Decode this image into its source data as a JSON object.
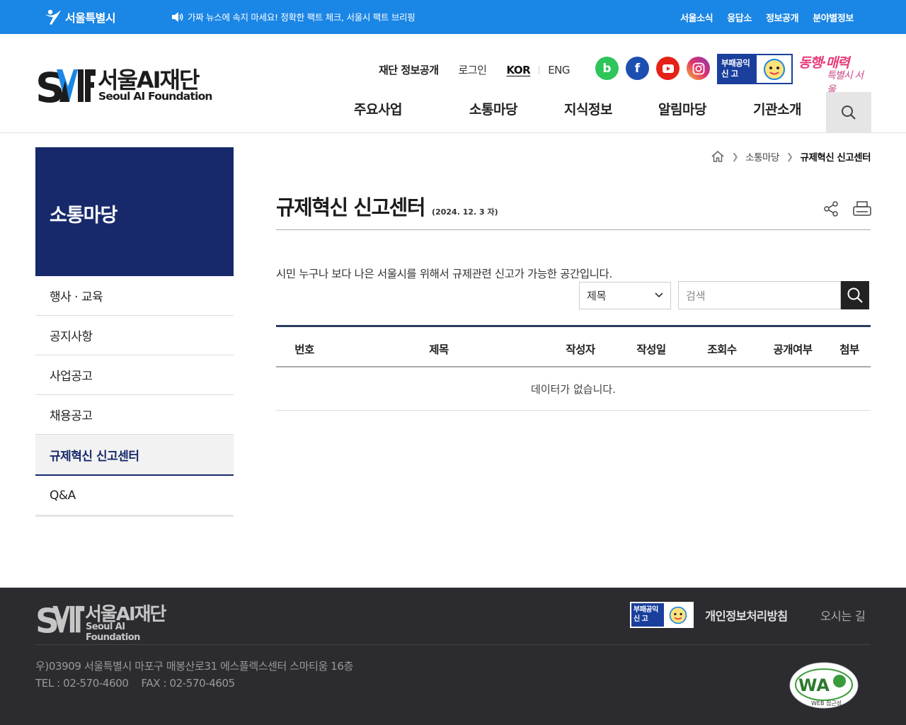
{
  "topbar": {
    "seoul_logo": "서울특별시",
    "ticker": "가짜 뉴스에 속지 마세요! 정확한 팩트 체크, 서울시 팩트 브리핑",
    "links": [
      "서울소식",
      "응답소",
      "정보공개",
      "분야별정보"
    ],
    "bg_color": "#1a86e5"
  },
  "header": {
    "brand_kor": "서울AI재단",
    "brand_eng": "Seoul AI Foundation",
    "util": {
      "disclosure": "재단 정보공개",
      "login": "로그인",
      "kor": "KOR",
      "eng": "ENG"
    },
    "social": [
      "blog-icon",
      "facebook-icon",
      "youtube-icon",
      "instagram-icon"
    ],
    "banner_text": "부패공익 신 고",
    "slogan_line1": "동행·매력",
    "slogan_line2": "특별시 서울",
    "gnb": [
      "주요사업",
      "소통마당",
      "지식정보",
      "알림마당",
      "기관소개"
    ]
  },
  "sidebar": {
    "title": "소통마당",
    "items": [
      {
        "label": "행사 · 교육"
      },
      {
        "label": "공지사항"
      },
      {
        "label": "사업공고"
      },
      {
        "label": "채용공고"
      },
      {
        "label": "규제혁신 신고센터"
      },
      {
        "label": "Q&A"
      }
    ],
    "active_index": 4,
    "title_bg": "#17296b"
  },
  "breadcrumb": {
    "level1": "소통마당",
    "current": "규제혁신 신고센터"
  },
  "main": {
    "title": "규제혁신 신고센터",
    "date_note": "(2024. 12. 3 자)",
    "description": "시민 누구나 보다 나은 서울시를 위해서 규제관련 신고가 가능한 공간입니다.",
    "search": {
      "field": "제목",
      "placeholder": "검색"
    },
    "table": {
      "headers": [
        "번호",
        "제목",
        "작성자",
        "작성일",
        "조회수",
        "공개여부",
        "첨부"
      ],
      "empty_message": "데이터가 없습니다."
    }
  },
  "footer": {
    "brand_kor": "서울AI재단",
    "brand_eng": "Seoul AI Foundation",
    "banner_text": "부패공익 신 고",
    "privacy": "개인정보처리방침",
    "location": "오시는 길",
    "address": "우)03909 서울특별시 마포구 매봉산로31 에스플렉스센터 스마티움 16층",
    "tel": "TEL : 02-570-4600",
    "fax": "FAX : 02-570-4605",
    "wa_label": "WEB 접근성",
    "wa_mark": "WA"
  }
}
